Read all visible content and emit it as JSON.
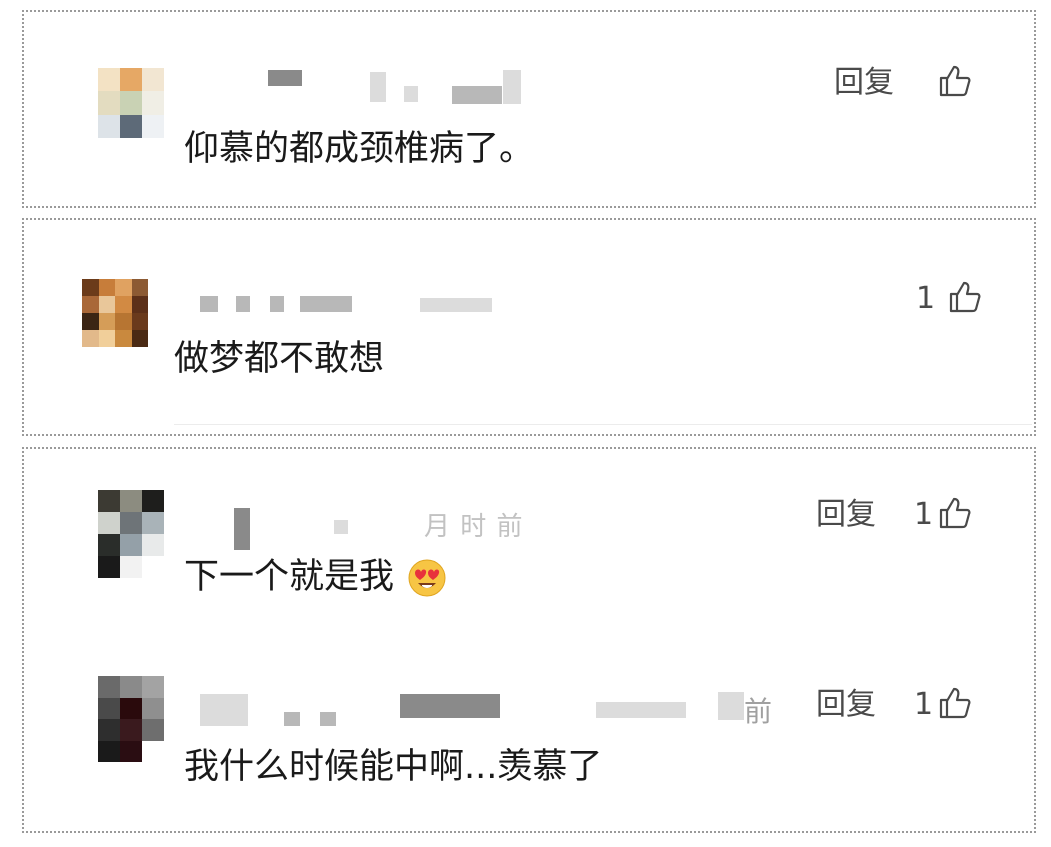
{
  "comments": [
    {
      "text": "仰慕的都成颈椎病了。",
      "reply_label": "回复",
      "likes": ""
    },
    {
      "text": "做梦都不敢想",
      "reply_label": "",
      "likes": "1"
    },
    {
      "text": "下一个就是我",
      "meta_fragment": "月 时 前",
      "reply_label": "回复",
      "likes": "1",
      "emoji": "heart-eyes-emoji"
    },
    {
      "text": "我什么时候能中啊...羡慕了",
      "meta_fragment": "前",
      "reply_label": "回复",
      "likes": "1"
    }
  ],
  "colors": {
    "text": "#1a1a1a",
    "secondary": "#4a4a4a",
    "meta": "#c2c2c2",
    "border": "#9a9a9a"
  }
}
